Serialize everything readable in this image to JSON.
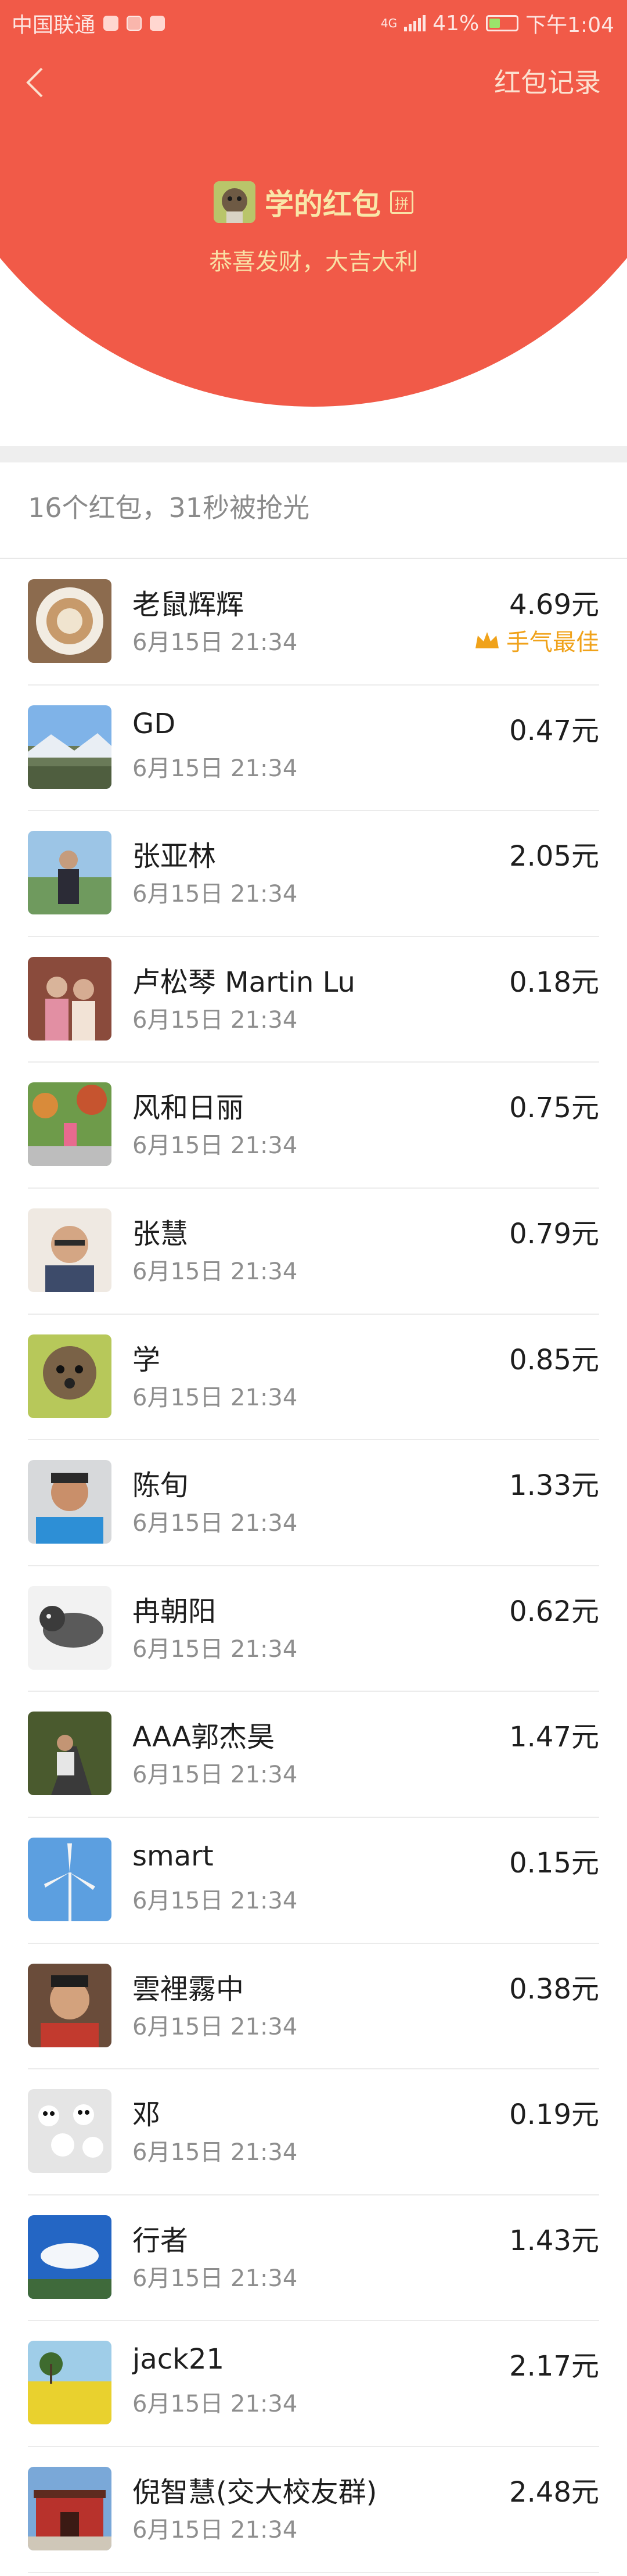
{
  "status_bar": {
    "carrier": "中国联通",
    "network": "4G",
    "battery": "41%",
    "battery_level": 0.41,
    "time": "下午1:04"
  },
  "header": {
    "back_icon": "chevron-left-icon",
    "records_label": "红包记录",
    "title": "学的红包",
    "pin_badge": "拼",
    "greeting": "恭喜发财，大吉大利"
  },
  "summary": "16个红包，31秒被抢光",
  "colors": {
    "header_red": "#f15a48",
    "title_gold": "#f9e6a8",
    "best_luck": "#f0a21a"
  },
  "recipients": [
    {
      "name": "老鼠辉辉",
      "time": "6月15日  21:34",
      "amount": "4.69元",
      "best": "手气最佳",
      "avatar": "coffee-cup"
    },
    {
      "name": "GD",
      "time": "6月15日  21:34",
      "amount": "0.47元",
      "avatar": "mountain-sky"
    },
    {
      "name": "张亚林",
      "time": "6月15日  21:34",
      "amount": "2.05元",
      "avatar": "man-lake"
    },
    {
      "name": "卢松琴 Martin Lu",
      "time": "6月15日  21:34",
      "amount": "0.18元",
      "avatar": "couple"
    },
    {
      "name": "风和日丽",
      "time": "6月15日  21:34",
      "amount": "0.75元",
      "avatar": "flowers-park"
    },
    {
      "name": "张慧",
      "time": "6月15日  21:34",
      "amount": "0.79元",
      "avatar": "man-glasses"
    },
    {
      "name": "学",
      "time": "6月15日  21:34",
      "amount": "0.85元",
      "avatar": "poodle"
    },
    {
      "name": "陈旬",
      "time": "6月15日  21:34",
      "amount": "1.33元",
      "avatar": "man-blue-shirt"
    },
    {
      "name": "冉朝阳",
      "time": "6月15日  21:34",
      "amount": "0.62元",
      "avatar": "dog-sketch"
    },
    {
      "name": "AAA郭杰昊",
      "time": "6月15日  21:34",
      "amount": "1.47元",
      "avatar": "scooter-road"
    },
    {
      "name": "smart",
      "time": "6月15日  21:34",
      "amount": "0.15元",
      "avatar": "wind-turbine"
    },
    {
      "name": "雲裡霧中",
      "time": "6月15日  21:34",
      "amount": "0.38元",
      "avatar": "man-portrait"
    },
    {
      "name": "邓",
      "time": "6月15日  21:34",
      "amount": "0.19元",
      "avatar": "pandas"
    },
    {
      "name": "行者",
      "time": "6月15日  21:34",
      "amount": "1.43元",
      "avatar": "blue-sky-clouds"
    },
    {
      "name": "jack21",
      "time": "6月15日  21:34",
      "amount": "2.17元",
      "avatar": "rapeseed-field"
    },
    {
      "name": "倪智慧(交大校友群)",
      "time": "6月15日  21:34",
      "amount": "2.48元",
      "avatar": "red-gate"
    }
  ]
}
